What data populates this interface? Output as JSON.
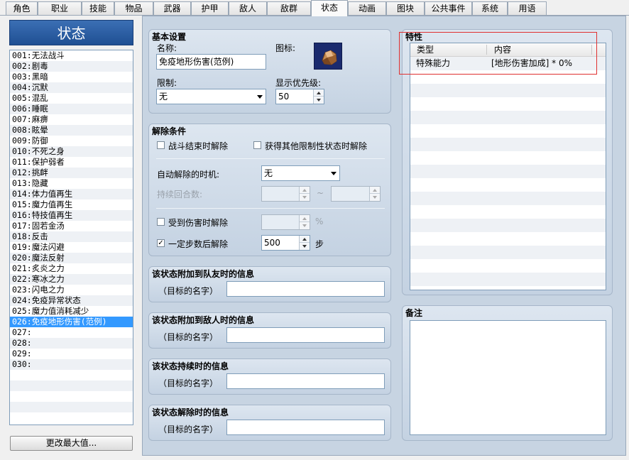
{
  "tabs": [
    "角色",
    "职业",
    "技能",
    "物品",
    "武器",
    "护甲",
    "敌人",
    "敌群",
    "状态",
    "动画",
    "图块",
    "公共事件",
    "系统",
    "用语"
  ],
  "active_tab": "状态",
  "list": {
    "header": "状态",
    "items": [
      "001:无法战斗",
      "002:剧毒",
      "003:黑暗",
      "004:沉默",
      "005:混乱",
      "006:睡眠",
      "007:麻痹",
      "008:眩晕",
      "009:防御",
      "010:不死之身",
      "011:保护弱者",
      "012:挑衅",
      "013:隐藏",
      "014:体力值再生",
      "015:魔力值再生",
      "016:特技值再生",
      "017:固若金汤",
      "018:反击",
      "019:魔法闪避",
      "020:魔法反射",
      "021:炙炎之力",
      "022:寒冰之力",
      "023:闪电之力",
      "024:免疫异常状态",
      "025:魔力值消耗减少",
      "026:免疫地形伤害(范例)",
      "027:",
      "028:",
      "029:",
      "030:"
    ],
    "selected_index": 25,
    "change_max_button": "更改最大值..."
  },
  "basic": {
    "title": "基本设置",
    "name_label": "名称:",
    "name_value": "免疫地形伤害(范例)",
    "icon_label": "图标:",
    "restriction_label": "限制:",
    "restriction_value": "无",
    "priority_label": "显示优先级:",
    "priority_value": "50"
  },
  "removal": {
    "title": "解除条件",
    "battle_end_label": "战斗结束时解除",
    "battle_end_checked": false,
    "restrict_label": "获得其他限制性状态时解除",
    "restrict_checked": false,
    "auto_timing_label": "自动解除的时机:",
    "auto_timing_value": "无",
    "turns_label": "持续回合数:",
    "turns_min": "",
    "turns_sep": "~",
    "turns_max": "",
    "damage_label": "受到伤害时解除",
    "damage_checked": false,
    "damage_value": "",
    "damage_unit": "%",
    "steps_label": "一定步数后解除",
    "steps_checked": true,
    "steps_value": "500",
    "steps_unit": "步"
  },
  "messages": [
    {
      "title": "该状态附加到队友时的信息",
      "prefix": "（目标的名字）",
      "value": ""
    },
    {
      "title": "该状态附加到敌人时的信息",
      "prefix": "（目标的名字）",
      "value": ""
    },
    {
      "title": "该状态持续时的信息",
      "prefix": "（目标的名字）",
      "value": ""
    },
    {
      "title": "该状态解除时的信息",
      "prefix": "（目标的名字）",
      "value": ""
    }
  ],
  "traits": {
    "title": "特性",
    "col_type": "类型",
    "col_content": "内容",
    "rows": [
      {
        "type": "特殊能力",
        "content": "[地形伤害加成] * 0%"
      }
    ]
  },
  "notes": {
    "title": "备注",
    "value": ""
  },
  "colors": {
    "panel_bg": "#c7d4e2",
    "selection": "#3399ff",
    "header_blue": "#2a5ea3",
    "highlight_red": "#e03030"
  }
}
